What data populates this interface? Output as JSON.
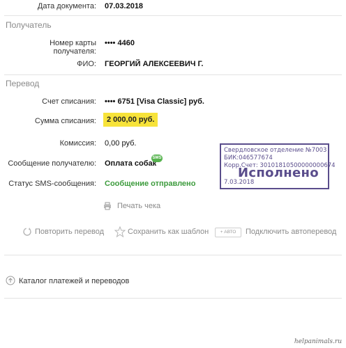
{
  "document": {
    "date_label": "Дата документа:",
    "date_value": "07.03.2018"
  },
  "recipient": {
    "section_title": "Получатель",
    "card_label": "Номер карты получателя:",
    "card_value": "•••• 4460",
    "name_label": "ФИО:",
    "name_value": "ГЕОРГИЙ АЛЕКСЕЕВИЧ Г."
  },
  "transfer": {
    "section_title": "Перевод",
    "account_label": "Счет списания:",
    "account_value": "•••• 6751  [Visa Classic]  руб.",
    "amount_label": "Сумма списания:",
    "amount_value": "2 000,00  руб.",
    "fee_label": "Комиссия:",
    "fee_value": "0,00 руб.",
    "message_label": "Сообщение получателю:",
    "message_value": "Оплата собак",
    "sms_badge": "SMS",
    "sms_status_label": "Статус SMS-сообщения:",
    "sms_status_value": "Сообщение отправлено",
    "print_label": "Печать чека"
  },
  "stamp": {
    "line1": "Свердловское отделение №7003",
    "line2": "БИК:046577674",
    "line3": "Корр.Счет: 30101810500000000674",
    "status": "Исполнено",
    "date": "7.03.2018"
  },
  "actions": {
    "repeat": "Повторить перевод",
    "save_template": "Сохранить как шаблон",
    "auto_badge": "+ АВТО",
    "auto_transfer": "Подключить автоперевод"
  },
  "catalog": {
    "label": "Каталог платежей и переводов"
  },
  "watermark": "helpanimals.ru",
  "colors": {
    "accent_green": "#3c9b3c",
    "highlight": "#f7e33a",
    "stamp": "#5a4d8c"
  }
}
